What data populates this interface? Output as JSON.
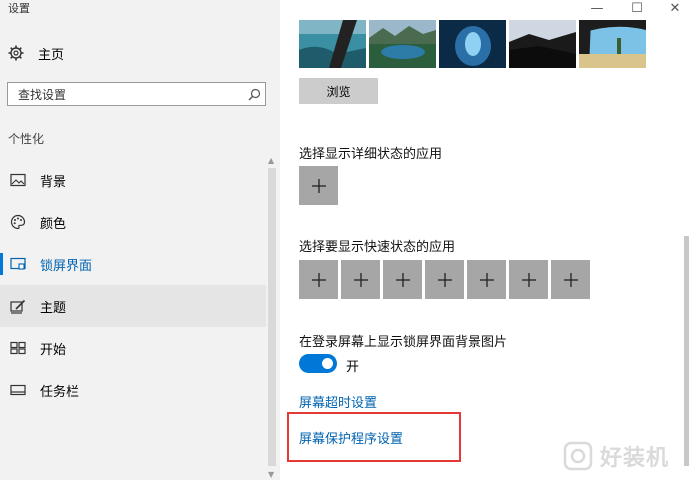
{
  "window": {
    "title": "设置",
    "controls": {
      "minimize": "—",
      "maximize": "☐",
      "close": "✕"
    }
  },
  "sidebar": {
    "home_label": "主页",
    "search_placeholder": "查找设置",
    "section_label": "个性化",
    "items": [
      {
        "label": "背景",
        "icon": "image-icon"
      },
      {
        "label": "颜色",
        "icon": "palette-icon"
      },
      {
        "label": "锁屏界面",
        "icon": "lock-screen-icon",
        "selected": true
      },
      {
        "label": "主题",
        "icon": "theme-icon",
        "hovered": true
      },
      {
        "label": "开始",
        "icon": "start-icon"
      },
      {
        "label": "任务栏",
        "icon": "taskbar-icon"
      }
    ]
  },
  "main": {
    "browse_label": "浏览",
    "detailed_status_heading": "选择显示详细状态的应用",
    "quick_status_heading": "选择要显示快速状态的应用",
    "quick_status_slots": 7,
    "show_background_heading": "在登录屏幕上显示锁屏界面背景图片",
    "toggle_state_label": "开",
    "toggle_on": true,
    "screen_timeout_link": "屏幕超时设置",
    "screensaver_link": "屏幕保护程序设置"
  },
  "watermark": {
    "text": "好装机"
  },
  "colors": {
    "accent": "#0078d7",
    "link": "#0063b1",
    "sidebar_bg": "#f2f2f2",
    "highlight_box": "#e53935",
    "plus_tile": "#a6a6a6"
  }
}
